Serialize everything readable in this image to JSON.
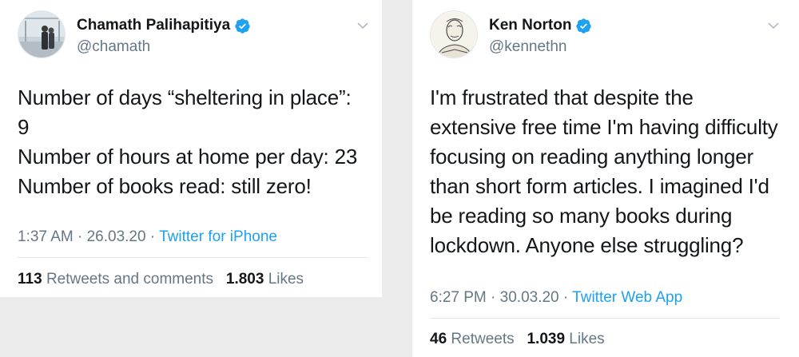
{
  "colors": {
    "background": "#ebebeb",
    "card": "#ffffff",
    "text_primary": "#14171a",
    "text_secondary": "#657786",
    "link": "#1da1f2",
    "verified": "#1da1f2",
    "divider": "#e1e8ed"
  },
  "tweets": [
    {
      "display_name": "Chamath Palihapitiya",
      "handle": "@chamath",
      "verified_icon": "verified-badge-icon",
      "text_lines": [
        "Number of days “sheltering in place”:",
        "9",
        "Number of hours at home per day: 23",
        "Number of books read: still zero!"
      ],
      "time": "1:37 AM",
      "date": "26.03.20",
      "source": "Twitter for iPhone",
      "retweets_count": "113",
      "retweets_label": "Retweets and comments",
      "likes_count": "1.803",
      "likes_label": "Likes"
    },
    {
      "display_name": "Ken Norton",
      "handle": "@kennethn",
      "verified_icon": "verified-badge-icon",
      "text_lines": [
        "I'm frustrated that despite the",
        "extensive free time I'm having difficulty",
        "focusing on reading anything longer",
        "than short form articles. I imagined I'd",
        "be reading so many books during",
        "lockdown. Anyone else struggling?"
      ],
      "time": "6:27 PM",
      "date": "30.03.20",
      "source": "Twitter Web App",
      "retweets_count": "46",
      "retweets_label": "Retweets",
      "likes_count": "1.039",
      "likes_label": "Likes"
    }
  ]
}
